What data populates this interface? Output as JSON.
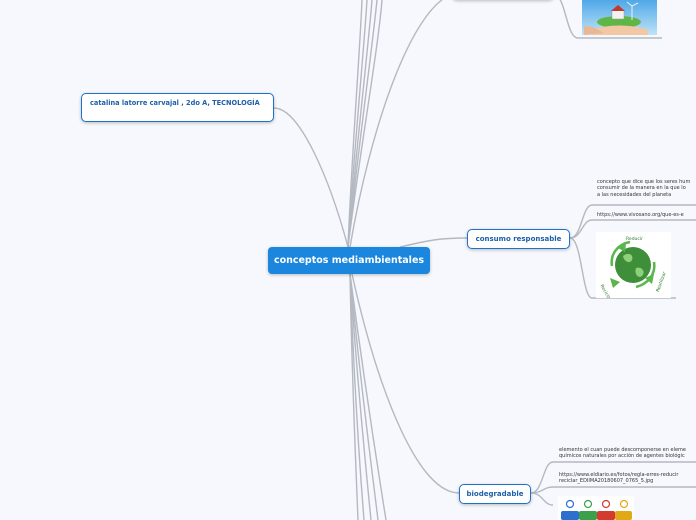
{
  "central_topic": "conceptos mediambientales",
  "author": "catalina latorre carvajal , 2do A, TECNOLOGÍA",
  "consumo": {
    "label": "consumo responsable",
    "note_line1": "concepto que dice que los seres hum",
    "note_line2": "consumir de la manera en la que lo",
    "note_line3": "a las necesidades del planeta",
    "url": "https://www.vivosano.org/que-es-e",
    "image_caption": [
      "Reducir",
      "Reutilizar",
      "Reciclar"
    ]
  },
  "biodegradable": {
    "label": "biodegradable",
    "note_line1": "elemento el cuan puede descomponerse en eleme",
    "note_line2": "químicos naturales por acción de agentes biológic",
    "url_line1": "https://www.eldiario.es/fotos/regla-erres-reducir",
    "url_line2": "reciclar_EDIIMA20180607_0765_5.jpg"
  },
  "colors": {
    "central_bg": "#1a86dd",
    "node_border": "#1d72c9",
    "node_text": "#1d5fa8",
    "connector": "#b4b8c0",
    "background": "#f6f8fd"
  }
}
